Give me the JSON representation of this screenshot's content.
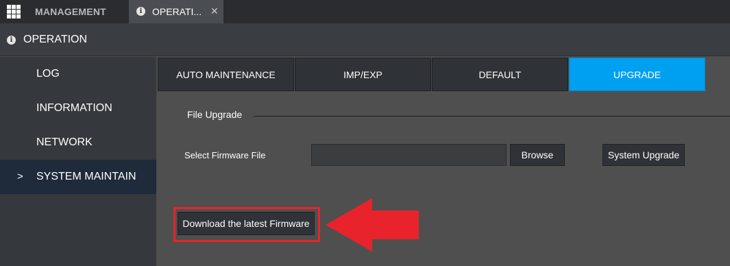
{
  "topbar": {
    "management_label": "MANAGEMENT",
    "active_tab_label": "OPERATI...",
    "close_glyph": "✕"
  },
  "header": {
    "icon_glyph": "i",
    "title": "OPERATION"
  },
  "sidebar": {
    "items": [
      {
        "label": "LOG"
      },
      {
        "label": "INFORMATION"
      },
      {
        "label": "NETWORK"
      },
      {
        "label": "SYSTEM MAINTAIN",
        "active": true
      }
    ],
    "active_chevron": ">"
  },
  "subtabs": [
    {
      "label": "AUTO MAINTENANCE"
    },
    {
      "label": "IMP/EXP"
    },
    {
      "label": "DEFAULT"
    },
    {
      "label": "UPGRADE",
      "active": true
    }
  ],
  "upgrade": {
    "group_label": "File Upgrade",
    "select_label": "Select Firmware File",
    "file_value": "",
    "browse_label": "Browse",
    "system_upgrade_label": "System Upgrade",
    "download_label": "Download the latest Firmware"
  },
  "colors": {
    "accent": "#00a0f0",
    "highlight": "#e8232b",
    "active_sidebar": "#1f2a3a"
  },
  "icons": [
    "apps-grid-icon",
    "info-icon",
    "close-icon",
    "chevron-right-icon",
    "red-arrow-annotation"
  ]
}
